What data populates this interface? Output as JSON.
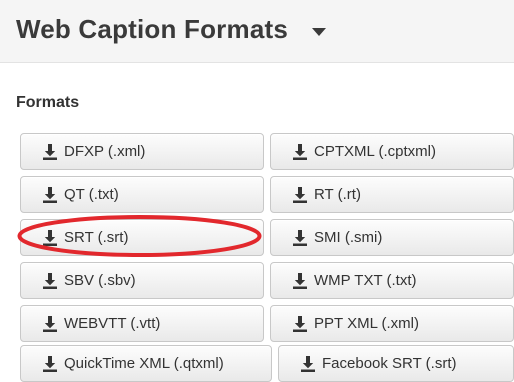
{
  "header": {
    "title": "Web Caption Formats",
    "dropdown_icon": "caret-down-icon"
  },
  "section": {
    "title": "Formats"
  },
  "icons": {
    "button_icon": "download-icon"
  },
  "highlight": {
    "color": "#e2282d",
    "target": "SRT (.srt)"
  },
  "buttons": [
    {
      "label": "DFXP (.xml)"
    },
    {
      "label": "CPTXML (.cptxml)"
    },
    {
      "label": "QT (.txt)"
    },
    {
      "label": "RT (.rt)"
    },
    {
      "label": "SRT (.srt)"
    },
    {
      "label": "SMI (.smi)"
    },
    {
      "label": "SBV (.sbv)"
    },
    {
      "label": "WMP TXT (.txt)"
    },
    {
      "label": "WEBVTT (.vtt)"
    },
    {
      "label": "PPT XML (.xml)"
    },
    {
      "label": "QuickTime XML (.qtxml)"
    },
    {
      "label": "Facebook SRT (.srt)"
    }
  ]
}
